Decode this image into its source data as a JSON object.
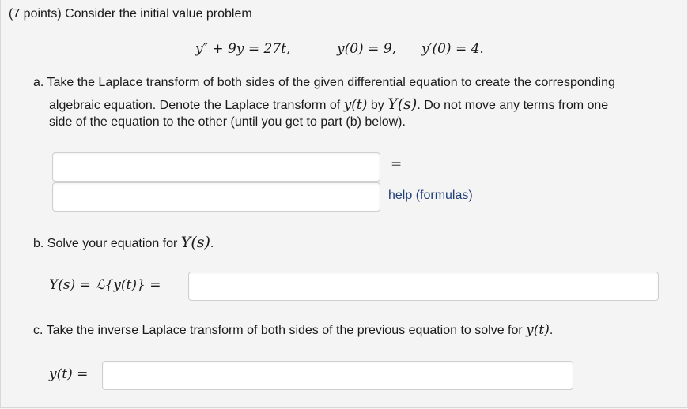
{
  "problem": {
    "header": "(7 points) Consider the initial value problem",
    "ode_lhs": "y″ + 9y = 27t,",
    "ic1": "y(0) = 9,",
    "ic2": "y′(0) = 4."
  },
  "part_a": {
    "line1": "a. Take the Laplace transform of both sides of the given differential equation to create the corresponding",
    "line2_pre": "algebraic equation. Denote the Laplace transform of ",
    "line2_y": "y(t)",
    "line2_mid": " by ",
    "line2_Y": "Y(s)",
    "line2_post": ". Do not move any terms from one",
    "line3": "side of the equation to the other (until you get to part (b) below).",
    "lhs_value": "",
    "rhs_value": "",
    "equals": "=",
    "help_link": "help (formulas)"
  },
  "part_b": {
    "prompt_pre": "b. Solve your equation for ",
    "prompt_Y": "Y(s)",
    "prompt_post": ".",
    "label": "Y(s) = ℒ{y(t)} =",
    "value": ""
  },
  "part_c": {
    "prompt_pre": "c. Take the inverse Laplace transform of both sides of the previous equation to solve for ",
    "prompt_y": "y(t)",
    "prompt_post": ".",
    "label": "y(t) =",
    "value": ""
  }
}
